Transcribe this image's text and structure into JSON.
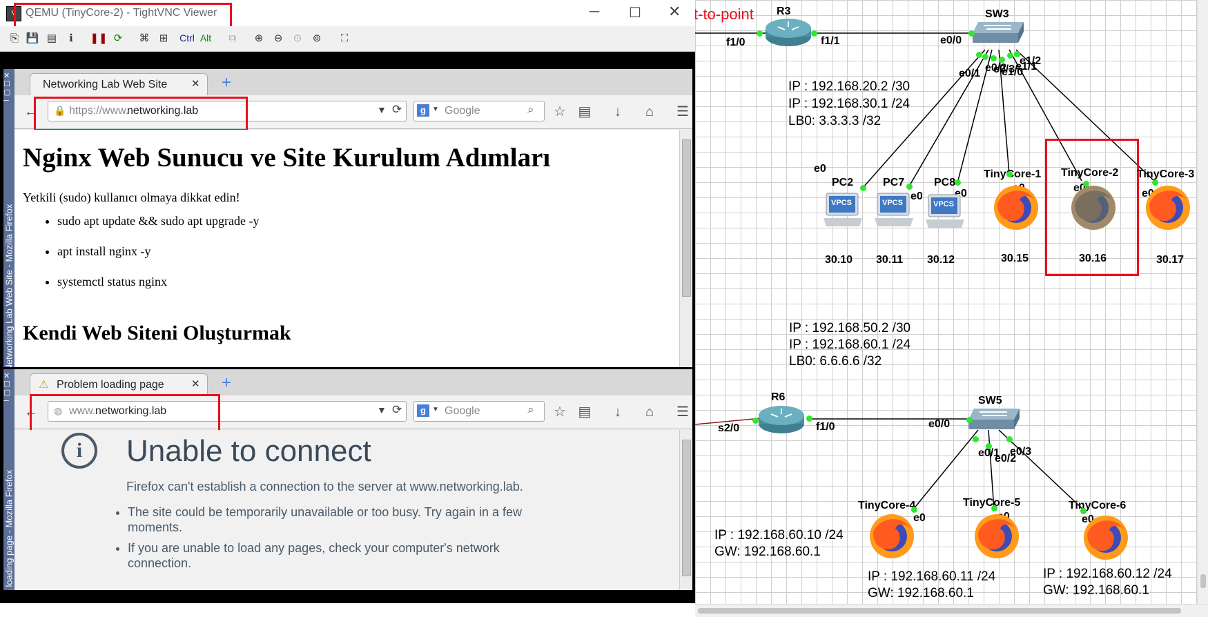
{
  "vnc": {
    "title": "QEMU (TinyCore-2) - TightVNC Viewer",
    "toolbar_ctrl": "Ctrl",
    "toolbar_alt": "Alt"
  },
  "ff1": {
    "side_title": "Networking Lab Web Site - Mozilla Firefox",
    "tab_title": "Networking Lab Web Site",
    "url_prefix": "https://www.",
    "url_domain": "networking.lab",
    "search_placeholder": "Google",
    "h1": "Nginx Web Sunucu ve Site Kurulum Adımları",
    "warning": "Yetkili (sudo) kullanıcı olmaya dikkat edin!",
    "steps": [
      "sudo apt update && sudo apt upgrade -y",
      "apt install nginx -y",
      "systemctl status nginx"
    ],
    "h2": "Kendi Web Siteni Oluşturmak"
  },
  "ff2": {
    "side_title": "Problem loading page - Mozilla Firefox",
    "tab_title": "Problem loading page",
    "url_prefix": "www.",
    "url_domain": "networking.lab",
    "search_placeholder": "Google",
    "error_title": "Unable to connect",
    "error_desc": "Firefox can't establish a connection to the server at www.networking.lab.",
    "bullets": [
      "The site could be temporarily unavailable or too busy. Try again in a few moments.",
      "If you are unable to load any pages, check your computer's network connection."
    ]
  },
  "topology": {
    "p2p_label": "t-to-point",
    "r3": {
      "name": "R3",
      "if_left": "f1/0",
      "if_right": "f1/1"
    },
    "sw3": {
      "name": "SW3",
      "e00": "e0/0",
      "e01": "e0/1",
      "e_stack": "e0/2",
      "e12": "e1/2",
      "e11": "e1/1",
      "e10": "e1/0",
      "e03": "e0/3"
    },
    "net1": [
      "IP : 192.168.20.2 /30",
      "IP : 192.168.30.1 /24",
      "LB0: 3.3.3.3 /32"
    ],
    "hosts1": [
      {
        "name": "PC2",
        "if": "e0",
        "ip": "30.10"
      },
      {
        "name": "PC7",
        "if": "e0",
        "ip": "30.11"
      },
      {
        "name": "PC8",
        "if": "e0",
        "ip": "30.12"
      },
      {
        "name": "TinyCore-1",
        "if": "e0",
        "ip": "30.15"
      },
      {
        "name": "TinyCore-2",
        "if": "e0",
        "ip": "30.16"
      },
      {
        "name": "TinyCore-3",
        "if": "e0",
        "ip": "30.17"
      }
    ],
    "vpcs_label": "VPCS",
    "net2": [
      "IP : 192.168.50.2 /30",
      "IP : 192.168.60.1 /24",
      "LB0: 6.6.6.6 /32"
    ],
    "r6": {
      "name": "R6",
      "if_left": "s2/0",
      "if_right": "f1/0"
    },
    "sw5": {
      "name": "SW5",
      "e00": "e0/0",
      "e01": "e0/1",
      "e02": "e0/2",
      "e03": "e0/3"
    },
    "hosts2": [
      {
        "name": "TinyCore-4",
        "if": "e0",
        "ip": "IP : 192.168.60.10 /24",
        "gw": "GW: 192.168.60.1"
      },
      {
        "name": "TinyCore-5",
        "if": "e0",
        "ip": "IP : 192.168.60.11 /24",
        "gw": "GW: 192.168.60.1"
      },
      {
        "name": "TinyCore-6",
        "if": "e0",
        "ip": "IP : 192.168.60.12 /24",
        "gw": "GW: 192.168.60.1"
      }
    ]
  },
  "colors": {
    "highlight": "#e8101c",
    "link_dot": "#2ee82e",
    "router": "#4a8fa0",
    "firefox_orange": "#ff7a1a"
  }
}
